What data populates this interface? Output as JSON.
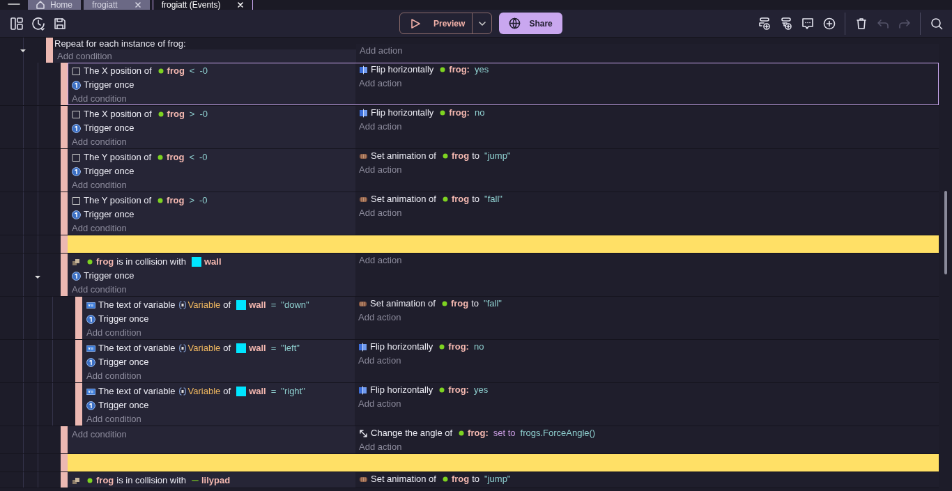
{
  "tabs": [
    {
      "label": "Home",
      "kind": "home",
      "selected": false
    },
    {
      "label": "frogiatt",
      "kind": "closable",
      "selected": false
    },
    {
      "label": "frogiatt (Events)",
      "kind": "closable",
      "selected": true
    }
  ],
  "toolbar_left": [
    {
      "kind": "panels"
    },
    {
      "kind": "history"
    },
    {
      "kind": "save"
    }
  ],
  "preview_button": {
    "label": "Preview"
  },
  "share_button": {
    "label": "Share"
  },
  "toolbar_right": [
    {
      "kind": "add-event",
      "disabled": false
    },
    {
      "kind": "add-subevent",
      "disabled": false
    },
    {
      "kind": "comment",
      "disabled": false
    },
    {
      "kind": "add",
      "disabled": false
    },
    {
      "kind": "separator"
    },
    {
      "kind": "delete",
      "disabled": false
    },
    {
      "kind": "undo",
      "disabled": true
    },
    {
      "kind": "redo",
      "disabled": true
    },
    {
      "kind": "separator"
    },
    {
      "kind": "search",
      "disabled": false
    }
  ],
  "events": [
    {
      "kind": "repeat",
      "title": "Repeat for each instance of frog:",
      "selected": false,
      "expanded": true,
      "add_condition": "Add condition",
      "add_action": "Add action",
      "children": [
        {
          "kind": "standard",
          "selected": true,
          "conditions": [
            {
              "kind": "position",
              "parts": [
                {
                  "kind": "text",
                  "text": "The X position of"
                },
                {
                  "kind": "sprite",
                  "text": "frog",
                  "color": "#7ed321"
                },
                {
                  "kind": "value",
                  "text": "<"
                },
                {
                  "kind": "value",
                  "text": "-0"
                }
              ]
            },
            {
              "kind": "once",
              "parts": [
                {
                  "kind": "text",
                  "text": "Trigger once"
                }
              ]
            }
          ],
          "actions": [
            {
              "kind": "flip",
              "parts": [
                {
                  "kind": "text",
                  "text": "Flip horizontally"
                },
                {
                  "kind": "sprite",
                  "text": "frog:",
                  "color": "#7ed321"
                },
                {
                  "kind": "value",
                  "text": "yes"
                }
              ]
            }
          ],
          "add_condition": "Add condition",
          "add_action": "Add action"
        },
        {
          "kind": "standard",
          "selected": false,
          "conditions": [
            {
              "kind": "position",
              "parts": [
                {
                  "kind": "text",
                  "text": "The X position of"
                },
                {
                  "kind": "sprite",
                  "text": "frog",
                  "color": "#7ed321"
                },
                {
                  "kind": "value",
                  "text": ">"
                },
                {
                  "kind": "value",
                  "text": "-0"
                }
              ]
            },
            {
              "kind": "once",
              "parts": [
                {
                  "kind": "text",
                  "text": "Trigger once"
                }
              ]
            }
          ],
          "actions": [
            {
              "kind": "flip",
              "parts": [
                {
                  "kind": "text",
                  "text": "Flip horizontally"
                },
                {
                  "kind": "sprite",
                  "text": "frog:",
                  "color": "#7ed321"
                },
                {
                  "kind": "value",
                  "text": "no"
                }
              ]
            }
          ],
          "add_condition": "Add condition",
          "add_action": "Add action"
        },
        {
          "kind": "standard",
          "selected": false,
          "conditions": [
            {
              "kind": "position",
              "parts": [
                {
                  "kind": "text",
                  "text": "The Y position of"
                },
                {
                  "kind": "sprite",
                  "text": "frog",
                  "color": "#7ed321"
                },
                {
                  "kind": "value",
                  "text": "<"
                },
                {
                  "kind": "value",
                  "text": "-0"
                }
              ]
            },
            {
              "kind": "once",
              "parts": [
                {
                  "kind": "text",
                  "text": "Trigger once"
                }
              ]
            }
          ],
          "actions": [
            {
              "kind": "animation",
              "parts": [
                {
                  "kind": "text",
                  "text": "Set animation of"
                },
                {
                  "kind": "sprite",
                  "text": "frog",
                  "color": "#7ed321"
                },
                {
                  "kind": "text",
                  "text": "to"
                },
                {
                  "kind": "value",
                  "text": "\"jump\""
                }
              ]
            }
          ],
          "add_condition": "Add condition",
          "add_action": "Add action"
        },
        {
          "kind": "standard",
          "selected": false,
          "conditions": [
            {
              "kind": "position",
              "parts": [
                {
                  "kind": "text",
                  "text": "The Y position of"
                },
                {
                  "kind": "sprite",
                  "text": "frog",
                  "color": "#7ed321"
                },
                {
                  "kind": "value",
                  "text": ">"
                },
                {
                  "kind": "value",
                  "text": "-0"
                }
              ]
            },
            {
              "kind": "once",
              "parts": [
                {
                  "kind": "text",
                  "text": "Trigger once"
                }
              ]
            }
          ],
          "actions": [
            {
              "kind": "animation",
              "parts": [
                {
                  "kind": "text",
                  "text": "Set animation of"
                },
                {
                  "kind": "sprite",
                  "text": "frog",
                  "color": "#7ed321"
                },
                {
                  "kind": "text",
                  "text": "to"
                },
                {
                  "kind": "value",
                  "text": "\"fall\""
                }
              ]
            }
          ],
          "add_condition": "Add condition",
          "add_action": "Add action"
        },
        {
          "kind": "comment",
          "selected": false
        },
        {
          "kind": "standard",
          "selected": false,
          "expanded": true,
          "conditions": [
            {
              "kind": "collision",
              "parts": [
                {
                  "kind": "sprite",
                  "text": "frog",
                  "color": "#7ed321"
                },
                {
                  "kind": "text",
                  "text": "is in collision with"
                },
                {
                  "kind": "block",
                  "text": "wall",
                  "color": "#00e5ff"
                }
              ]
            },
            {
              "kind": "once",
              "parts": [
                {
                  "kind": "text",
                  "text": "Trigger once"
                }
              ]
            }
          ],
          "add_condition": "Add condition",
          "add_action": "Add action",
          "children": [
            {
              "kind": "standard",
              "selected": false,
              "conditions": [
                {
                  "kind": "variable",
                  "parts": [
                    {
                      "kind": "text",
                      "text": "The text of variable"
                    },
                    {
                      "kind": "variable",
                      "text": "Variable"
                    },
                    {
                      "kind": "text",
                      "text": "of"
                    },
                    {
                      "kind": "block",
                      "text": "wall",
                      "color": "#00e5ff"
                    },
                    {
                      "kind": "value",
                      "text": "="
                    },
                    {
                      "kind": "value",
                      "text": "\"down\""
                    }
                  ]
                },
                {
                  "kind": "once",
                  "parts": [
                    {
                      "kind": "text",
                      "text": "Trigger once"
                    }
                  ]
                }
              ],
              "actions": [
                {
                  "kind": "animation",
                  "parts": [
                    {
                      "kind": "text",
                      "text": "Set animation of"
                    },
                    {
                      "kind": "sprite",
                      "text": "frog",
                      "color": "#7ed321"
                    },
                    {
                      "kind": "text",
                      "text": "to"
                    },
                    {
                      "kind": "value",
                      "text": "\"fall\""
                    }
                  ]
                }
              ],
              "add_condition": "Add condition",
              "add_action": "Add action"
            },
            {
              "kind": "standard",
              "selected": false,
              "conditions": [
                {
                  "kind": "variable",
                  "parts": [
                    {
                      "kind": "text",
                      "text": "The text of variable"
                    },
                    {
                      "kind": "variable",
                      "text": "Variable"
                    },
                    {
                      "kind": "text",
                      "text": "of"
                    },
                    {
                      "kind": "block",
                      "text": "wall",
                      "color": "#00e5ff"
                    },
                    {
                      "kind": "value",
                      "text": "="
                    },
                    {
                      "kind": "value",
                      "text": "\"left\""
                    }
                  ]
                },
                {
                  "kind": "once",
                  "parts": [
                    {
                      "kind": "text",
                      "text": "Trigger once"
                    }
                  ]
                }
              ],
              "actions": [
                {
                  "kind": "flip",
                  "parts": [
                    {
                      "kind": "text",
                      "text": "Flip horizontally"
                    },
                    {
                      "kind": "sprite",
                      "text": "frog:",
                      "color": "#7ed321"
                    },
                    {
                      "kind": "value",
                      "text": "no"
                    }
                  ]
                }
              ],
              "add_condition": "Add condition",
              "add_action": "Add action"
            },
            {
              "kind": "standard",
              "selected": false,
              "conditions": [
                {
                  "kind": "variable",
                  "parts": [
                    {
                      "kind": "text",
                      "text": "The text of variable"
                    },
                    {
                      "kind": "variable",
                      "text": "Variable"
                    },
                    {
                      "kind": "text",
                      "text": "of"
                    },
                    {
                      "kind": "block",
                      "text": "wall",
                      "color": "#00e5ff"
                    },
                    {
                      "kind": "value",
                      "text": "="
                    },
                    {
                      "kind": "value",
                      "text": "\"right\""
                    }
                  ]
                },
                {
                  "kind": "once",
                  "parts": [
                    {
                      "kind": "text",
                      "text": "Trigger once"
                    }
                  ]
                }
              ],
              "actions": [
                {
                  "kind": "flip",
                  "parts": [
                    {
                      "kind": "text",
                      "text": "Flip horizontally"
                    },
                    {
                      "kind": "sprite",
                      "text": "frog:",
                      "color": "#7ed321"
                    },
                    {
                      "kind": "value",
                      "text": "yes"
                    }
                  ]
                }
              ],
              "add_condition": "Add condition",
              "add_action": "Add action"
            }
          ]
        },
        {
          "kind": "standard",
          "selected": false,
          "actions": [
            {
              "kind": "angle",
              "parts": [
                {
                  "kind": "text",
                  "text": "Change the angle of"
                },
                {
                  "kind": "sprite",
                  "text": "frog:",
                  "color": "#7ed321"
                },
                {
                  "kind": "keyword",
                  "text": "set to"
                },
                {
                  "kind": "value",
                  "text": "frogs.ForceAngle()"
                }
              ]
            }
          ],
          "add_condition": "Add condition",
          "add_action": "Add action"
        },
        {
          "kind": "comment",
          "selected": false
        },
        {
          "kind": "standard",
          "selected": false,
          "conditions": [
            {
              "kind": "collision",
              "parts": [
                {
                  "kind": "sprite",
                  "text": "frog",
                  "color": "#7ed321"
                },
                {
                  "kind": "text",
                  "text": "is in collision with"
                },
                {
                  "kind": "line",
                  "text": "lilypad",
                  "color": "#5a8a2a"
                }
              ]
            }
          ],
          "actions": [
            {
              "kind": "animation",
              "parts": [
                {
                  "kind": "text",
                  "text": "Set animation of"
                },
                {
                  "kind": "sprite",
                  "text": "frog",
                  "color": "#7ed321"
                },
                {
                  "kind": "text",
                  "text": "to"
                },
                {
                  "kind": "value",
                  "text": "\"jump\""
                }
              ]
            }
          ]
        }
      ]
    }
  ]
}
